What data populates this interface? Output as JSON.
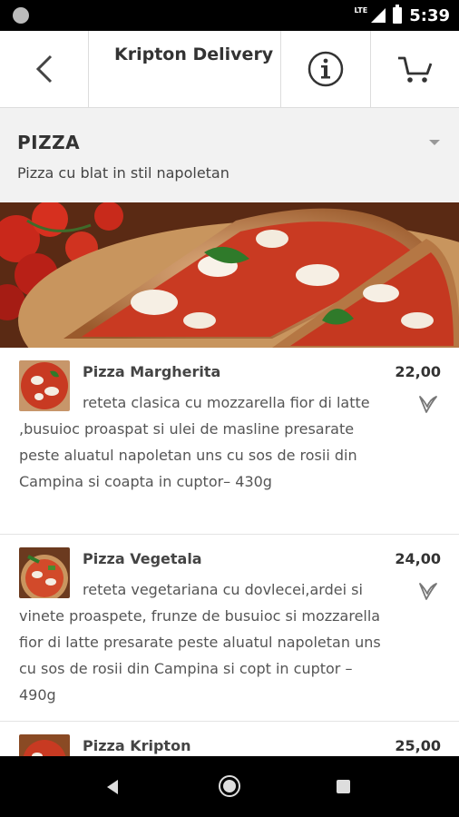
{
  "statusbar": {
    "time": "5:39",
    "network": "LTE"
  },
  "appbar": {
    "title": "Kripton Delivery",
    "back_icon": "chevron-left-icon",
    "info_icon": "info-icon",
    "cart_icon": "cart-icon"
  },
  "category": {
    "title": "PIZZA",
    "subtitle": "Pizza cu blat in stil napoletan"
  },
  "items": [
    {
      "name": "Pizza Margherita",
      "price": "22,00",
      "description": "reteta clasica cu mozzarella fior di latte ,busuioc proaspat si ulei de masline presarate peste aluatul napoletan uns cu sos de rosii din Campina si coapta in cuptor– 430g"
    },
    {
      "name": "Pizza Vegetala",
      "price": "24,00",
      "description": "reteta vegetariana cu dovlecei,ardei si vinete proaspete, frunze de busuioc si mozzarella fior di latte presarate peste aluatul napoletan uns cu sos de rosii din Campina si copt in cuptor – 490g"
    },
    {
      "name": "Pizza Kripton",
      "price": "25,00",
      "description": ""
    }
  ],
  "colors": {
    "accent": "#333333",
    "category_bg": "#f2f2f2",
    "veg_icon": "#777777"
  }
}
